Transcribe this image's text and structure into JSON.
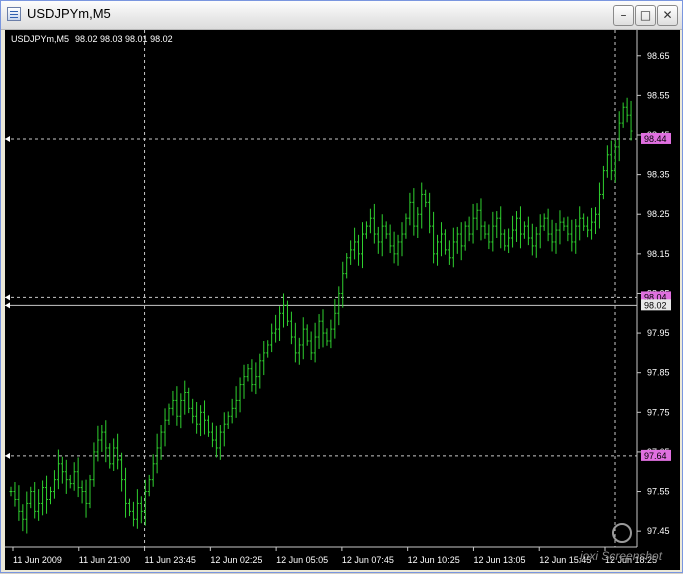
{
  "window": {
    "title": "USDJPYm,M5",
    "buttons": {
      "minimize": "–",
      "maximize": "□",
      "close": "✕"
    }
  },
  "chart_header": {
    "symbol": "USDJPYm,M5",
    "ohlc": "98.02 98.03 98.01 98.02"
  },
  "watermark": "joxi Screenshot",
  "colors": {
    "background": "#000000",
    "candles": "#2fd02f",
    "grid": "#c8c8c8",
    "price_tag": "#e070e0"
  },
  "chart_data": {
    "type": "bar",
    "ylim": [
      97.41,
      98.71
    ],
    "y_ticks": [
      "98.65",
      "98.55",
      "98.45",
      "98.35",
      "98.25",
      "98.15",
      "98.05",
      "97.95",
      "97.85",
      "97.75",
      "97.65",
      "97.55",
      "97.45"
    ],
    "x_ticks": [
      "11 Jun 2009",
      "11 Jun 21:00",
      "11 Jun 23:45",
      "12 Jun 02:25",
      "12 Jun 05:05",
      "12 Jun 07:45",
      "12 Jun 10:25",
      "12 Jun 13:05",
      "12 Jun 15:45",
      "12 Jun 18:25"
    ],
    "price_labels": [
      {
        "text": "98.44",
        "value": 98.44
      },
      {
        "text": "98.04",
        "value": 98.04
      },
      {
        "text": "98.02",
        "value": 98.02
      },
      {
        "text": "97.64",
        "value": 97.64
      }
    ],
    "horizontal_lines": [
      98.44,
      98.04,
      98.02,
      97.64
    ],
    "vertical_line_x_labels": [
      "11 Jun 23:45",
      "12 Jun 18:25"
    ],
    "series_close": [
      97.55,
      97.53,
      97.5,
      97.48,
      97.52,
      97.55,
      97.5,
      97.52,
      97.56,
      97.53,
      97.55,
      97.58,
      97.62,
      97.6,
      97.58,
      97.57,
      97.6,
      97.56,
      97.55,
      97.52,
      97.58,
      97.65,
      97.68,
      97.7,
      97.66,
      97.62,
      97.66,
      97.63,
      97.58,
      97.52,
      97.5,
      97.48,
      97.52,
      97.5,
      97.55,
      97.58,
      97.62,
      97.66,
      97.7,
      97.73,
      97.76,
      97.78,
      97.74,
      97.78,
      97.8,
      97.76,
      97.74,
      97.72,
      97.75,
      97.73,
      97.7,
      97.68,
      97.66,
      97.7,
      97.72,
      97.74,
      97.76,
      97.78,
      97.82,
      97.84,
      97.86,
      97.82,
      97.84,
      97.88,
      97.9,
      97.92,
      97.95,
      97.96,
      98.0,
      98.02,
      97.98,
      97.94,
      97.9,
      97.92,
      97.96,
      97.93,
      97.9,
      97.94,
      97.98,
      97.95,
      97.93,
      97.96,
      98.0,
      98.05,
      98.1,
      98.14,
      98.16,
      98.18,
      98.15,
      98.2,
      98.22,
      98.24,
      98.2,
      98.18,
      98.22,
      98.2,
      98.17,
      98.15,
      98.18,
      98.2,
      98.24,
      98.28,
      98.22,
      98.25,
      98.3,
      98.28,
      98.22,
      98.15,
      98.18,
      98.2,
      98.16,
      98.14,
      98.18,
      98.2,
      98.17,
      98.22,
      98.2,
      98.24,
      98.26,
      98.22,
      98.2,
      98.18,
      98.22,
      98.24,
      98.2,
      98.17,
      98.19,
      98.21,
      98.24,
      98.2,
      98.22,
      98.19,
      98.17,
      98.2,
      98.22,
      98.24,
      98.2,
      98.18,
      98.21,
      98.23,
      98.22,
      98.2,
      98.18,
      98.22,
      98.24,
      98.22,
      98.21,
      98.23,
      98.25,
      98.3,
      98.36,
      98.4,
      98.36,
      98.42,
      98.48,
      98.52,
      98.5,
      98.46
    ]
  }
}
